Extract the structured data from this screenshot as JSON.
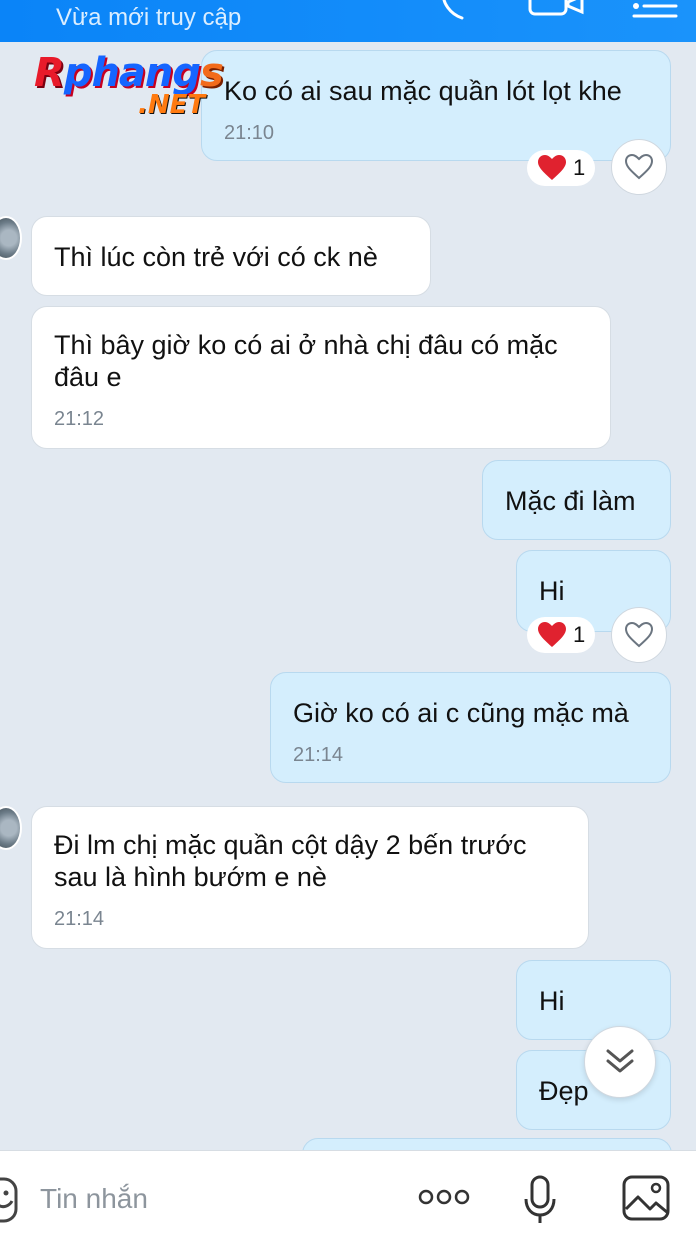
{
  "header": {
    "status": "Vừa mới truy cập",
    "icons": [
      "phone-icon",
      "video-icon",
      "menu-icon"
    ]
  },
  "watermark": {
    "main": "Rphangs",
    "sub": ".NET"
  },
  "messages": [
    {
      "side": "me",
      "text": "Ko có ai sau mặc quần lót lọt khe",
      "time": "21:10",
      "reaction_count": "1"
    },
    {
      "side": "them",
      "text": "Thì lúc còn trẻ với có ck nè",
      "time": ""
    },
    {
      "side": "them",
      "text": "Thì bây giờ ko có ai ở nhà chị đâu có mặc đâu e",
      "time": "21:12"
    },
    {
      "side": "me",
      "text": "Mặc đi làm",
      "time": ""
    },
    {
      "side": "me",
      "text": "Hi",
      "time": "",
      "reaction_count": "1"
    },
    {
      "side": "me",
      "text": "Giờ ko có ai c cũng mặc mà",
      "time": "21:14"
    },
    {
      "side": "them",
      "text": "Đi lm chị mặc quần cột dậy 2 bến trước sau là hình bướm e nè",
      "time": "21:14"
    },
    {
      "side": "me",
      "text": "Hi",
      "time": ""
    },
    {
      "side": "me",
      "text": "Đẹp",
      "time": ""
    }
  ],
  "composer": {
    "placeholder": "Tin nhắn",
    "icons": [
      "sticker-icon",
      "more-icon",
      "mic-icon",
      "image-icon"
    ]
  },
  "colors": {
    "header": "#1a8ffa",
    "background": "#e2e9f1",
    "my_bubble": "#d4eefd",
    "their_bubble": "#ffffff",
    "heart": "#e0222f"
  }
}
